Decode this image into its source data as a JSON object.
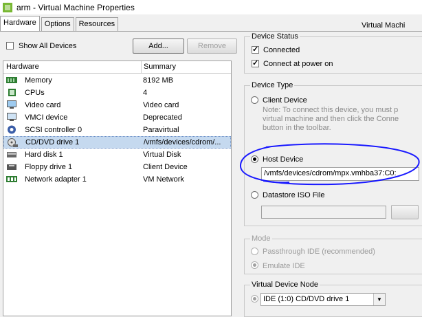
{
  "window": {
    "title": "arm - Virtual Machine Properties"
  },
  "tabs": [
    {
      "label": "Hardware",
      "active": true
    },
    {
      "label": "Options",
      "active": false
    },
    {
      "label": "Resources",
      "active": false
    }
  ],
  "tab_right_label": "Virtual Machi",
  "show_all_devices": {
    "label": "Show All Devices",
    "checked": false
  },
  "buttons": {
    "add": "Add...",
    "remove": "Remove"
  },
  "hardware_list": {
    "headers": {
      "hardware": "Hardware",
      "summary": "Summary"
    },
    "rows": [
      {
        "name": "Memory",
        "summary": "8192 MB",
        "icon": "memory-icon"
      },
      {
        "name": "CPUs",
        "summary": "4",
        "icon": "cpu-icon"
      },
      {
        "name": "Video card",
        "summary": "Video card",
        "icon": "video-card-icon"
      },
      {
        "name": "VMCI device",
        "summary": "Deprecated",
        "icon": "vmci-icon"
      },
      {
        "name": "SCSI controller 0",
        "summary": "Paravirtual",
        "icon": "scsi-icon"
      },
      {
        "name": "CD/DVD drive 1",
        "summary": "/vmfs/devices/cdrom/...",
        "icon": "cdrom-icon",
        "selected": true
      },
      {
        "name": "Hard disk 1",
        "summary": "Virtual Disk",
        "icon": "hard-disk-icon"
      },
      {
        "name": "Floppy drive 1",
        "summary": "Client Device",
        "icon": "floppy-icon"
      },
      {
        "name": "Network adapter 1",
        "summary": "VM Network",
        "icon": "network-icon"
      }
    ]
  },
  "device_status": {
    "title": "Device Status",
    "connected": {
      "label": "Connected",
      "checked": true
    },
    "connect_at_power_on": {
      "label": "Connect at power on",
      "checked": true
    }
  },
  "device_type": {
    "title": "Device Type",
    "client_device": {
      "label": "Client Device",
      "selected": false
    },
    "client_note": [
      "Note: To connect this device, you must p",
      "virtual machine and then click the Conne",
      "button in the toolbar."
    ],
    "host_device": {
      "label": "Host Device",
      "selected": true,
      "value": "/vmfs/devices/cdrom/mpx.vmhba37:C0:"
    },
    "datastore_iso": {
      "label": "Datastore ISO File",
      "selected": false,
      "value": ""
    }
  },
  "mode": {
    "title": "Mode",
    "passthrough": {
      "label": "Passthrough IDE (recommended)",
      "selected": false
    },
    "emulate": {
      "label": "Emulate IDE",
      "selected": true
    }
  },
  "virtual_device_node": {
    "title": "Virtual Device Node",
    "selected": "IDE (1:0) CD/DVD drive 1"
  },
  "colors": {
    "selection": "#c5d9ef",
    "annotation": "#1a1aff"
  }
}
